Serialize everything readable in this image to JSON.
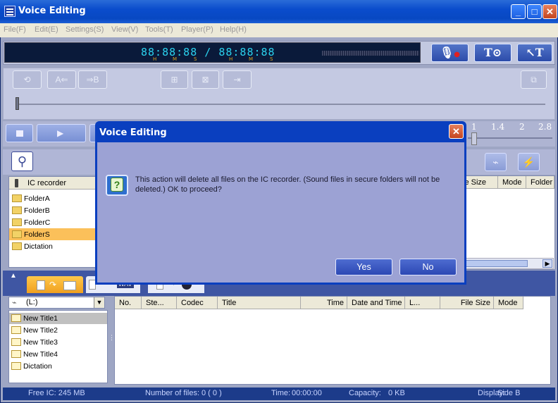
{
  "window": {
    "title": "Voice Editing"
  },
  "menu": [
    "File(F)",
    "Edit(E)",
    "Settings(S)",
    "View(V)",
    "Tools(T)",
    "Player(P)",
    "Help(H)"
  ],
  "display": {
    "time": "88:88:88 / 88:88:88",
    "units": [
      "H",
      "M",
      "S",
      "H",
      "M",
      "S"
    ]
  },
  "speed_marks": [
    "1",
    "1.4",
    "2",
    "2.8"
  ],
  "upper_tree": {
    "header": "IC recorder",
    "items": [
      "FolderA",
      "FolderB",
      "FolderC",
      "FolderS",
      "Dictation"
    ],
    "selected": "FolderS"
  },
  "upper_list": {
    "columns": [
      "le Size",
      "Mode",
      "Folder"
    ]
  },
  "drive": {
    "value": "(L:)"
  },
  "lower_tree": {
    "items": [
      "New Title1",
      "New Title2",
      "New Title3",
      "New Title4",
      "Dictation"
    ],
    "selected": "New Title1"
  },
  "lower_list": {
    "columns": [
      "No.",
      "Ste...",
      "Codec",
      "Title",
      "Time",
      "Date and Time",
      "L...",
      "File Size",
      "Mode"
    ]
  },
  "tabs": {
    "wav": "WAV"
  },
  "status": {
    "free": "Free IC: 245 MB",
    "files_label": "Number of files:",
    "files_value": "0 ( 0 )",
    "time_label": "Time:",
    "time_value": "00:00:00",
    "capacity_label": "Capacity:",
    "capacity_value": "0 KB",
    "display_label": "Display:",
    "display_value": "Side B"
  },
  "dialog": {
    "title": "Voice Editing",
    "message": "This action will delete all files on the IC recorder. (Sound files in secure folders will not be deleted.)  OK to proceed?",
    "yes": "Yes",
    "no": "No"
  },
  "colors": {
    "titlebar": "#0a4ccc",
    "dialog_body": "#9ca2d4",
    "selection": "#fbc05a"
  }
}
